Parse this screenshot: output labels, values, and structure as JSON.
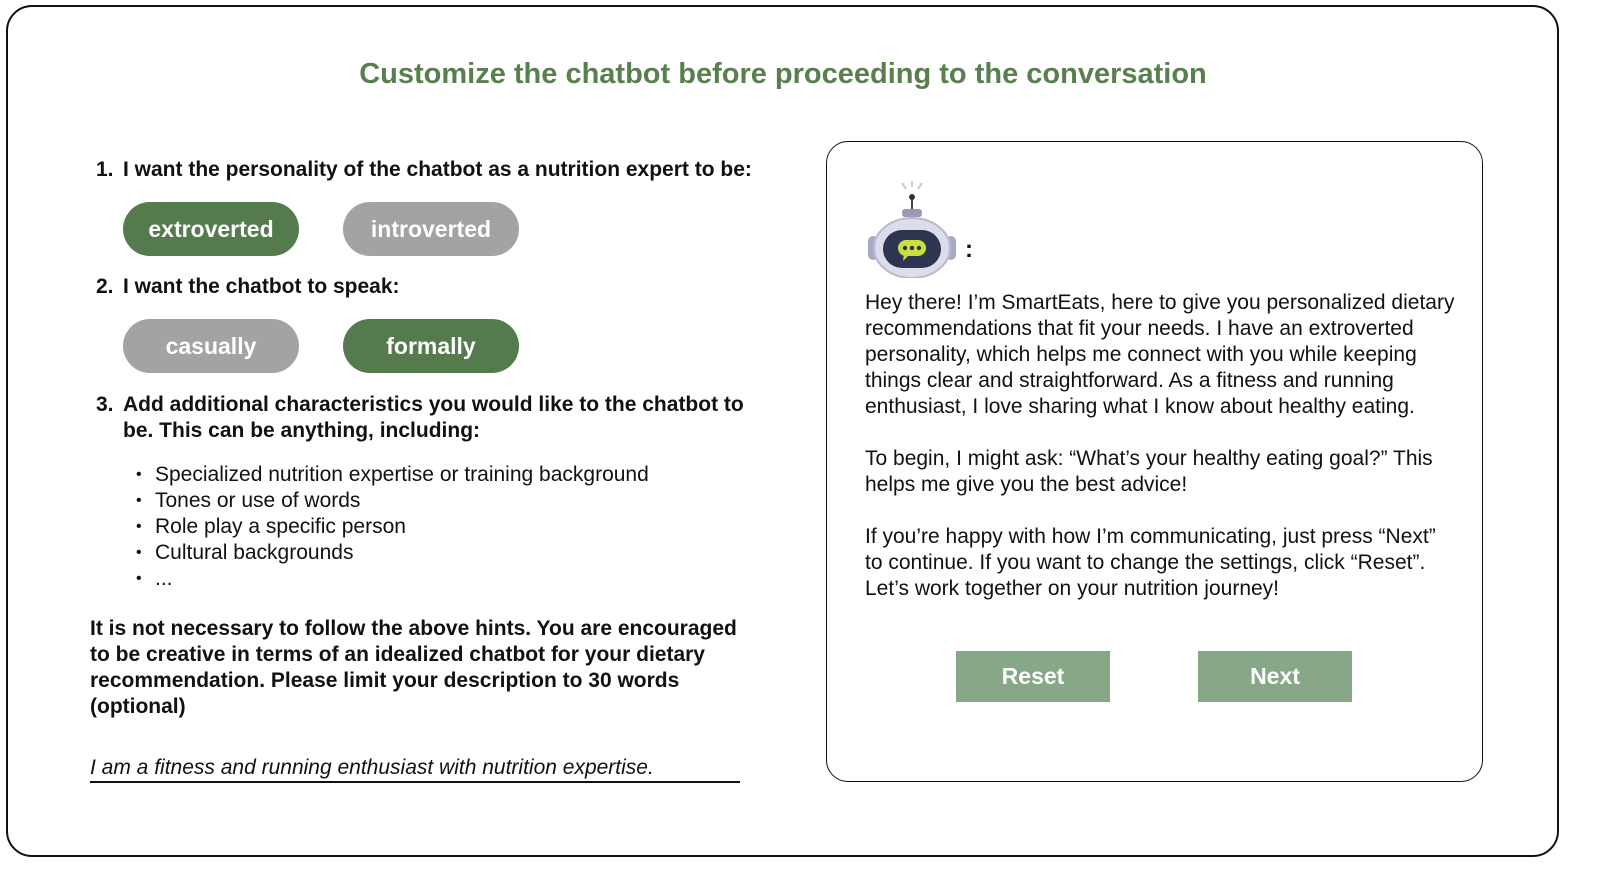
{
  "title": "Customize the chatbot before proceeding to the conversation",
  "questions": {
    "q1": {
      "number": "1.",
      "text": "I want the personality of the chatbot as a nutrition expert to be:",
      "options": [
        "extroverted",
        "introverted"
      ],
      "selected": "extroverted"
    },
    "q2": {
      "number": "2.",
      "text": "I want the chatbot to speak:",
      "options": [
        "casually",
        "formally"
      ],
      "selected": "formally"
    },
    "q3": {
      "number": "3.",
      "text": "Add additional characteristics you would like to the chatbot to be. This can be anything, including:",
      "hints": [
        "Specialized nutrition expertise or training background",
        "Tones or use of words",
        "Role play a specific person",
        "Cultural backgrounds",
        "..."
      ]
    }
  },
  "note": "It is not necessary to follow the above hints. You are encouraged to be creative in terms of an idealized chatbot for your dietary recommendation. Please limit your description to 30 words (optional)",
  "answer_value": "I am a fitness and running enthusiast with nutrition expertise.",
  "preview": {
    "speaker_suffix": ":",
    "avatar_icon": "robot-chat-icon",
    "paragraphs": [
      "Hey there! I’m SmartEats, here to give you personalized dietary recommendations that fit your needs. I have an extroverted personality, which helps me connect with you while keeping things clear and straightforward. As a fitness and running enthusiast, I love sharing what I know about healthy eating.",
      "To begin, I might ask: “What’s your healthy eating goal?” This helps me give you the best advice!",
      "If you’re happy with how I’m communicating, just press “Next” to continue. If you want to change the settings, click “Reset”. Let’s work together on your nutrition journey!"
    ],
    "reset_label": "Reset",
    "next_label": "Next"
  },
  "colors": {
    "title": "#5a7f4e",
    "selected": "#557a4e",
    "unselected": "#a3a3a3",
    "action_button": "#86a886"
  }
}
